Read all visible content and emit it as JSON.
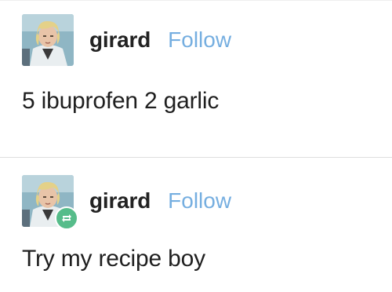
{
  "posts": [
    {
      "username": "girard",
      "follow_label": "Follow",
      "text": "5 ibuprofen 2 garlic",
      "avatar_icon": "avatar-photo",
      "reblogged": false
    },
    {
      "username": "girard",
      "follow_label": "Follow",
      "text": "Try my recipe boy",
      "avatar_icon": "avatar-photo",
      "reblogged": true,
      "reblog_icon": "reblog-icon"
    }
  ],
  "colors": {
    "follow": "#75aee0",
    "reblog_badge": "#56bc8a",
    "username": "#222222"
  }
}
